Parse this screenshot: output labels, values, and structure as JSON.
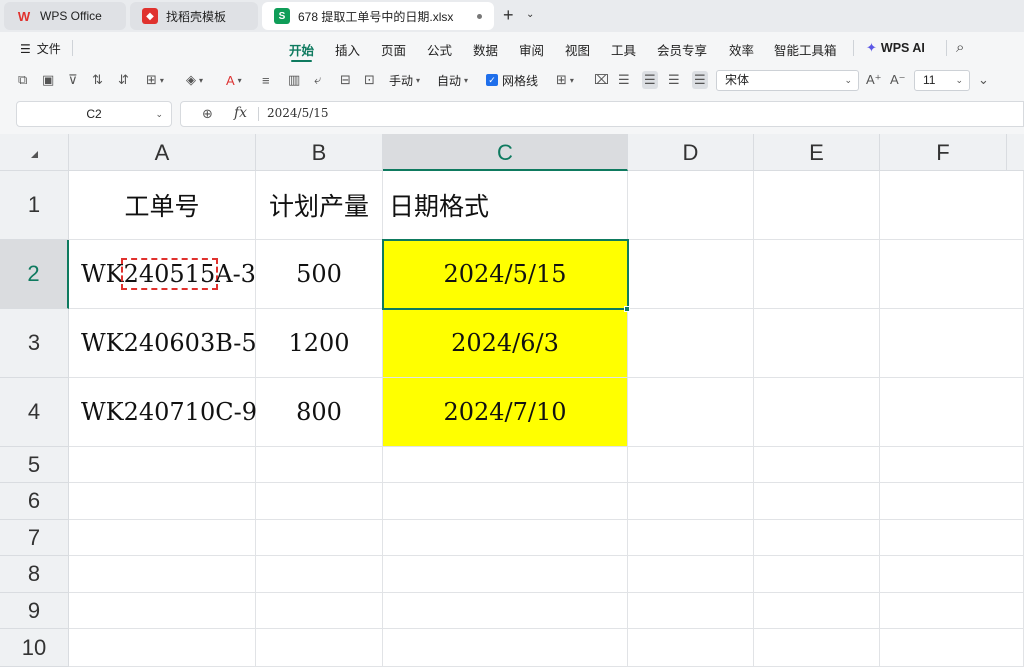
{
  "tabs": [
    {
      "label": "WPS Office",
      "icon": "wps-logo-icon"
    },
    {
      "label": "找稻壳模板",
      "icon": "docer-icon"
    },
    {
      "label": "678 提取工单号中的日期.xlsx",
      "icon": "S",
      "modified": true
    }
  ],
  "menu": {
    "file": "文件",
    "items": [
      "开始",
      "插入",
      "页面",
      "公式",
      "数据",
      "审阅",
      "视图",
      "工具",
      "会员专享",
      "效率",
      "智能工具箱"
    ],
    "active": "开始",
    "ai": "WPS AI"
  },
  "toolbar": {
    "wrap_manual": "手动",
    "wrap_auto": "自动",
    "gridlines": "网格线",
    "gridlines_checked": true,
    "font_name": "宋体",
    "font_size": "11"
  },
  "formula_bar": {
    "name_box": "C2",
    "fx": "fx",
    "value": "2024/5/15"
  },
  "sheet": {
    "columns": [
      "A",
      "B",
      "C",
      "D",
      "E",
      "F"
    ],
    "selected_column": "C",
    "rows": [
      "1",
      "2",
      "3",
      "4",
      "5",
      "6",
      "7",
      "8",
      "9",
      "10"
    ],
    "selected_row": "2",
    "selected_cell": "C2",
    "header_row": {
      "a": "工单号",
      "b": "计划产量",
      "c": "日期格式"
    },
    "data_rows": [
      {
        "a_prefix": "WK",
        "a_mid": "240515",
        "a_suffix": "A-3",
        "a_highlighted": true,
        "b": "500",
        "c": "2024/5/15"
      },
      {
        "a": "WK240603B-5",
        "b": "1200",
        "c": "2024/6/3"
      },
      {
        "a": "WK240710C-9",
        "b": "800",
        "c": "2024/7/10"
      }
    ],
    "fill_color": "#ffff00",
    "accent_color": "#0e7a5f",
    "marquee_color": "#e0322e"
  }
}
